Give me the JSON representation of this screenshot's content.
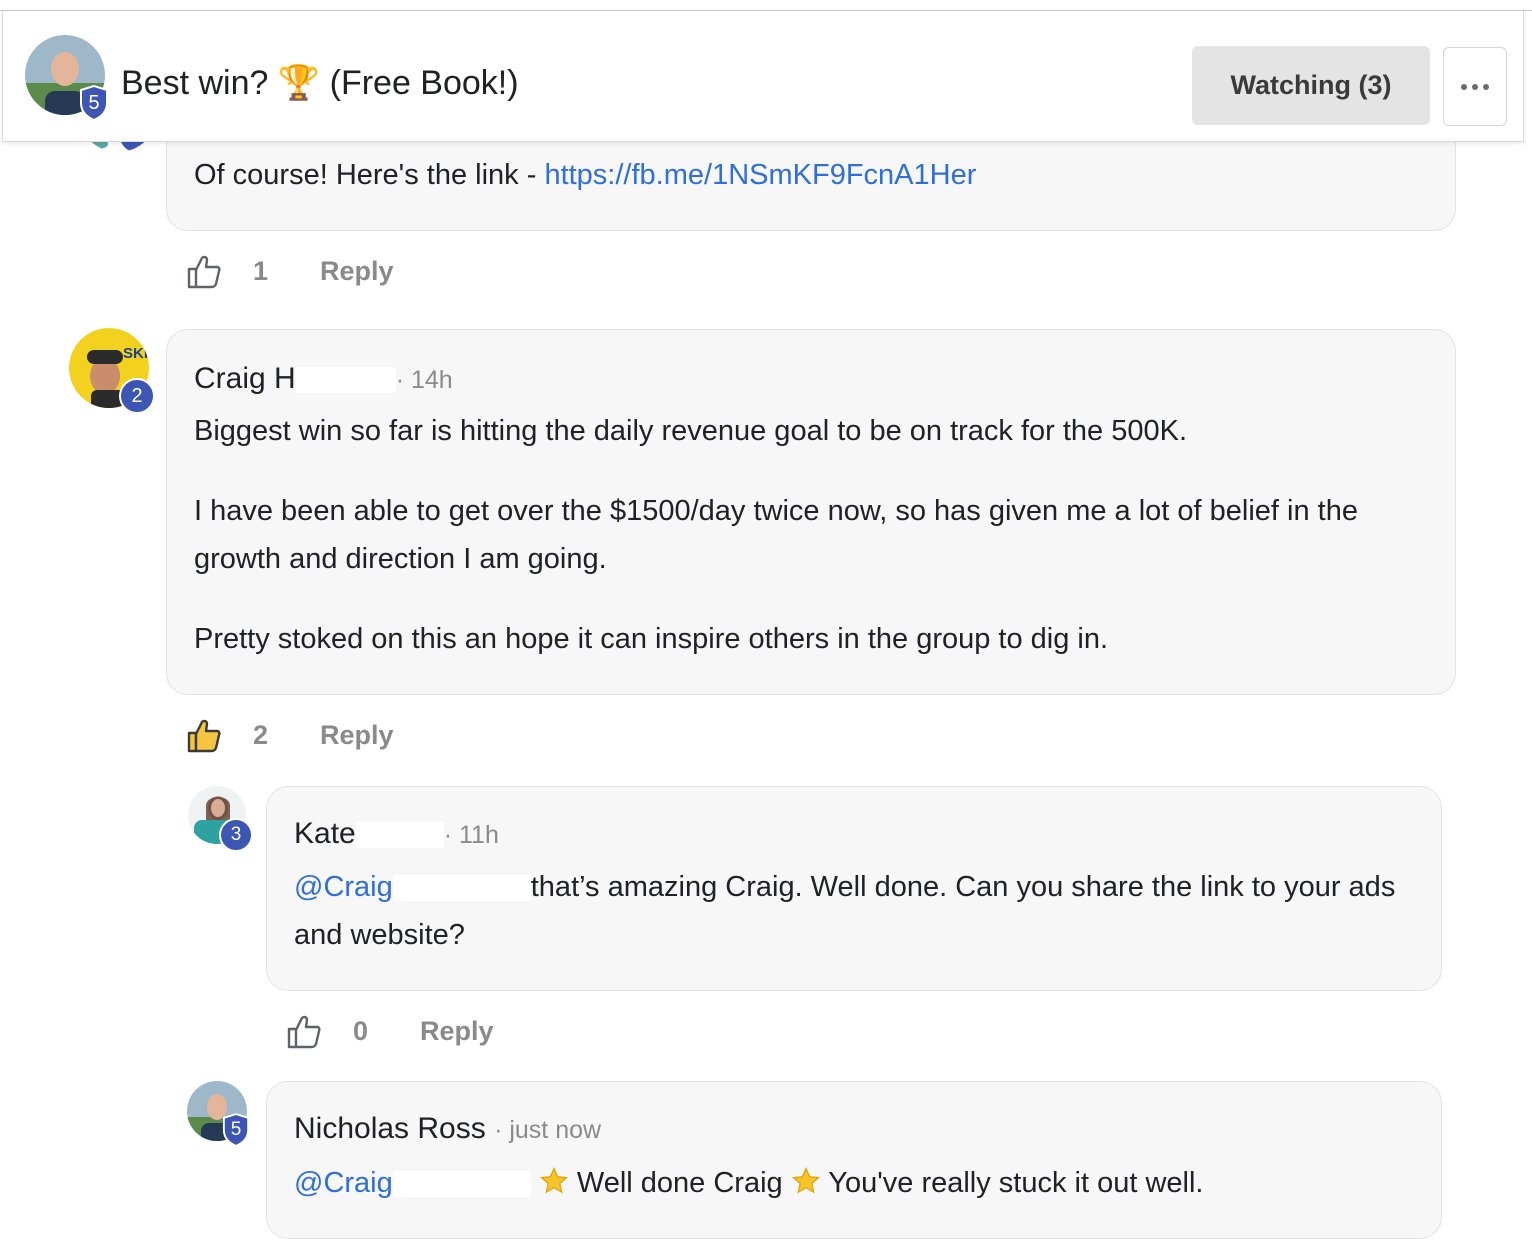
{
  "header": {
    "title": "Best win? 🏆 (Free Book!)",
    "author_level": "5",
    "watch_label": "Watching (3)",
    "more_label": "···"
  },
  "comments": [
    {
      "text_prefix": "Of course! Here's the link - ",
      "link": "https://fb.me/1NSmKF9FcnA1Her",
      "likes": "1",
      "reply_label": "Reply"
    },
    {
      "author": "Craig H",
      "level": "2",
      "time": "· 14h",
      "paragraphs": [
        "Biggest win so far is hitting the daily revenue goal to be on track for the 500K.",
        "I have been able to get over the $1500/day twice now, so has given me a lot of belief in the growth and direction I am going.",
        "Pretty stoked on this an hope it can inspire others in the group to dig in."
      ],
      "likes": "2",
      "reply_label": "Reply",
      "liked": true
    },
    {
      "author": "Kate",
      "level": "3",
      "time": "· 11h",
      "mention": "@Craig",
      "text": "that’s amazing Craig. Well done. Can you share the link to your ads and website?",
      "likes": "0",
      "reply_label": "Reply"
    },
    {
      "author": "Nicholas Ross",
      "level": "5",
      "time": "· just now",
      "mention": "@Craig",
      "text_a": "Well done Craig",
      "text_b": "You've really stuck it out well."
    }
  ],
  "colors": {
    "link": "#2f6fdc",
    "level_badge": "#3d55b3",
    "bubble_bg": "#f7f7f7",
    "like_active": "#f5c542"
  },
  "icons": [
    "thumbs-up-icon",
    "star-icon",
    "shield-icon",
    "more-icon"
  ]
}
